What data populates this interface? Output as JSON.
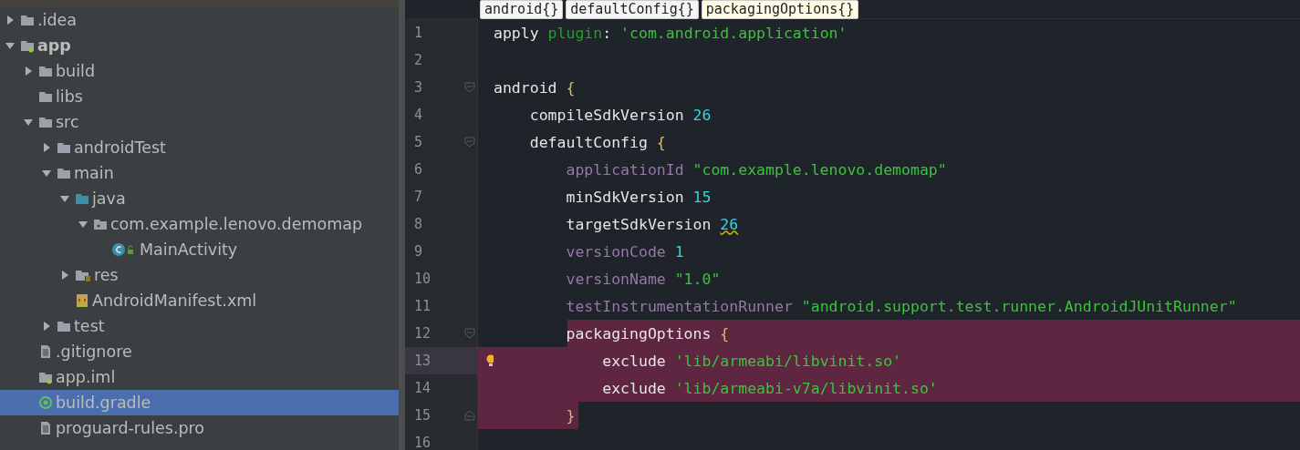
{
  "project_tree": [
    {
      "label": ".idea",
      "kind": "folder",
      "expanded": false,
      "selected": false
    },
    {
      "label": "app",
      "kind": "module",
      "expanded": true,
      "selected": false,
      "children": [
        {
          "label": "build",
          "kind": "folder",
          "expanded": false,
          "selected": false
        },
        {
          "label": "libs",
          "kind": "folder",
          "selected": false
        },
        {
          "label": "src",
          "kind": "folder",
          "expanded": true,
          "selected": false,
          "children": [
            {
              "label": "androidTest",
              "kind": "folder",
              "expanded": false,
              "selected": false
            },
            {
              "label": "main",
              "kind": "folder",
              "expanded": true,
              "selected": false,
              "children": [
                {
                  "label": "java",
                  "kind": "source",
                  "expanded": true,
                  "selected": false,
                  "children": [
                    {
                      "label": "com.example.lenovo.demomap",
                      "kind": "package",
                      "expanded": true,
                      "selected": false,
                      "children": [
                        {
                          "label": "MainActivity",
                          "kind": "class",
                          "selected": false
                        }
                      ]
                    }
                  ]
                },
                {
                  "label": "res",
                  "kind": "resources",
                  "expanded": false,
                  "selected": false
                },
                {
                  "label": "AndroidManifest.xml",
                  "kind": "manifest",
                  "selected": false
                }
              ]
            },
            {
              "label": "test",
              "kind": "folder",
              "expanded": false,
              "selected": false
            }
          ]
        },
        {
          "label": ".gitignore",
          "kind": "file",
          "selected": false
        },
        {
          "label": "app.iml",
          "kind": "iml",
          "selected": false
        },
        {
          "label": "build.gradle",
          "kind": "gradle",
          "selected": true
        },
        {
          "label": "proguard-rules.pro",
          "kind": "file",
          "selected": false
        }
      ]
    }
  ],
  "breadcrumbs": [
    {
      "label": "android{}",
      "selected": false
    },
    {
      "label": "defaultConfig{}",
      "selected": false
    },
    {
      "label": "packagingOptions{}",
      "selected": true
    }
  ],
  "editor": {
    "lines": [
      {
        "number": "1",
        "tokens": [
          {
            "kind": "plain",
            "text": "apply "
          },
          {
            "kind": "keyword",
            "text": "plugin"
          },
          {
            "kind": "plain",
            "text": ": "
          },
          {
            "kind": "string",
            "text": "'com.android.application'"
          }
        ]
      },
      {
        "number": "2"
      },
      {
        "number": "3",
        "foldable": true,
        "tokens": [
          {
            "kind": "plain",
            "text": "android "
          },
          {
            "kind": "brace",
            "text": "{"
          }
        ]
      },
      {
        "number": "4",
        "tokens": [
          {
            "kind": "plain",
            "text": "    compileSdkVersion "
          },
          {
            "kind": "number",
            "text": "26"
          }
        ]
      },
      {
        "number": "5",
        "foldable": true,
        "tokens": [
          {
            "kind": "plain",
            "text": "    defaultConfig "
          },
          {
            "kind": "brace",
            "text": "{"
          }
        ]
      },
      {
        "number": "6",
        "tokens": [
          {
            "kind": "property",
            "text": "        applicationId "
          },
          {
            "kind": "string",
            "text": "\"com.example.lenovo.demomap\""
          }
        ]
      },
      {
        "number": "7",
        "tokens": [
          {
            "kind": "plain",
            "text": "        minSdkVersion "
          },
          {
            "kind": "number",
            "text": "15"
          }
        ]
      },
      {
        "number": "8",
        "tokens": [
          {
            "kind": "plain",
            "text": "        targetSdkVersion "
          },
          {
            "kind": "warning",
            "text": "26"
          }
        ]
      },
      {
        "number": "9",
        "tokens": [
          {
            "kind": "property",
            "text": "        versionCode "
          },
          {
            "kind": "number",
            "text": "1"
          }
        ]
      },
      {
        "number": "10",
        "tokens": [
          {
            "kind": "property",
            "text": "        versionName "
          },
          {
            "kind": "string",
            "text": "\"1.0\""
          }
        ]
      },
      {
        "number": "11",
        "tokens": [
          {
            "kind": "property",
            "text": "        testInstrumentationRunner "
          },
          {
            "kind": "string",
            "text": "\"android.support.test.runner.AndroidJUnitRunner\""
          }
        ]
      },
      {
        "number": "12",
        "foldable": true,
        "selected": true,
        "tokens": [
          {
            "kind": "plain",
            "text": "        packagingOptions "
          },
          {
            "kind": "brace",
            "text": "{"
          }
        ]
      },
      {
        "number": "13",
        "selected": true,
        "current": true,
        "bulb": true,
        "tokens": [
          {
            "kind": "plain",
            "text": "            exclude "
          },
          {
            "kind": "string",
            "text": "'lib/armeabi/libvinit.so'"
          }
        ]
      },
      {
        "number": "14",
        "selected": true,
        "tokens": [
          {
            "kind": "plain",
            "text": "            exclude "
          },
          {
            "kind": "string",
            "text": "'lib/armeabi-v7a/libvinit.so'"
          }
        ]
      },
      {
        "number": "15",
        "fold_end": true,
        "selected": true,
        "tokens": [
          {
            "kind": "brace",
            "text": "        }"
          }
        ]
      },
      {
        "number": "16"
      }
    ]
  }
}
